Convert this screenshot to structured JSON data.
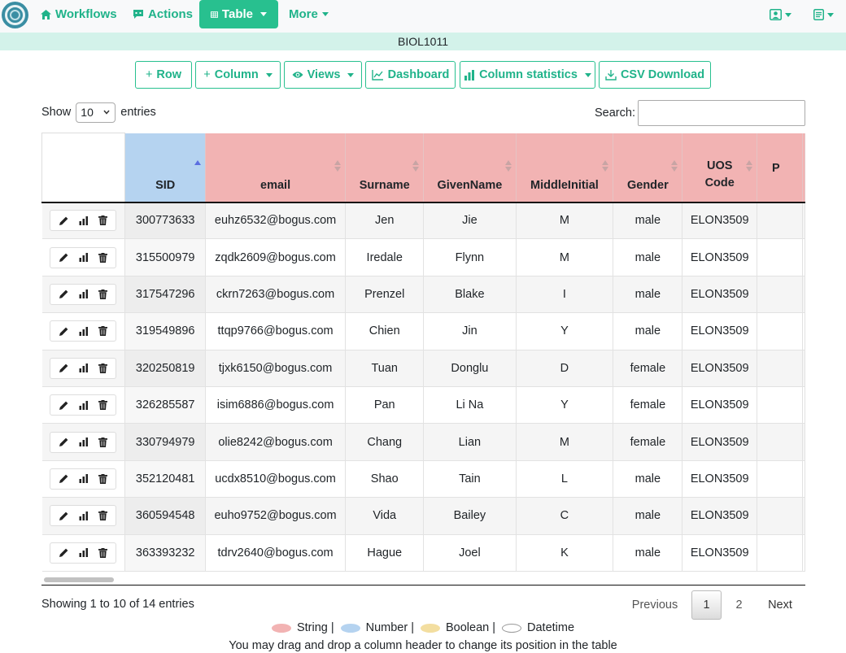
{
  "nav": {
    "workflows": "Workflows",
    "actions": "Actions",
    "table": "Table",
    "more": "More"
  },
  "title": "BIOL1011",
  "toolbar": {
    "row": "Row",
    "column": "Column",
    "views": "Views",
    "dashboard": "Dashboard",
    "column_statistics": "Column statistics",
    "csv_download": "CSV Download"
  },
  "controls": {
    "show": "Show",
    "entries_value": "10",
    "entries": "entries",
    "search": "Search:"
  },
  "columns": [
    "SID",
    "email",
    "Surname",
    "GivenName",
    "MiddleInitial",
    "Gender",
    "UOS Code",
    "P"
  ],
  "rows": [
    [
      "300773633",
      "euhz6532@bogus.com",
      "Jen",
      "Jie",
      "M",
      "male",
      "ELON3509"
    ],
    [
      "315500979",
      "zqdk2609@bogus.com",
      "Iredale",
      "Flynn",
      "M",
      "male",
      "ELON3509"
    ],
    [
      "317547296",
      "ckrn7263@bogus.com",
      "Prenzel",
      "Blake",
      "I",
      "male",
      "ELON3509"
    ],
    [
      "319549896",
      "ttqp9766@bogus.com",
      "Chien",
      "Jin",
      "Y",
      "male",
      "ELON3509"
    ],
    [
      "320250819",
      "tjxk6150@bogus.com",
      "Tuan",
      "Donglu",
      "D",
      "female",
      "ELON3509"
    ],
    [
      "326285587",
      "isim6886@bogus.com",
      "Pan",
      "Li Na",
      "Y",
      "female",
      "ELON3509"
    ],
    [
      "330794979",
      "olie8242@bogus.com",
      "Chang",
      "Lian",
      "M",
      "female",
      "ELON3509"
    ],
    [
      "352120481",
      "ucdx8510@bogus.com",
      "Shao",
      "Tain",
      "L",
      "male",
      "ELON3509"
    ],
    [
      "360594548",
      "euho9752@bogus.com",
      "Vida",
      "Bailey",
      "C",
      "male",
      "ELON3509"
    ],
    [
      "363393232",
      "tdrv2640@bogus.com",
      "Hague",
      "Joel",
      "K",
      "male",
      "ELON3509"
    ]
  ],
  "footer": {
    "info": "Showing 1 to 10 of 14 entries",
    "previous": "Previous",
    "page1": "1",
    "page2": "2",
    "next": "Next"
  },
  "legend": {
    "string": "String |",
    "number": "Number |",
    "boolean": "Boolean |",
    "datetime": "Datetime"
  },
  "note": "You may drag and drop a column header to change its position in the table",
  "colors": {
    "accent": "#28c08f",
    "string": "#f2b3b3",
    "number": "#b5d3f0",
    "boolean": "#f3dea0"
  }
}
